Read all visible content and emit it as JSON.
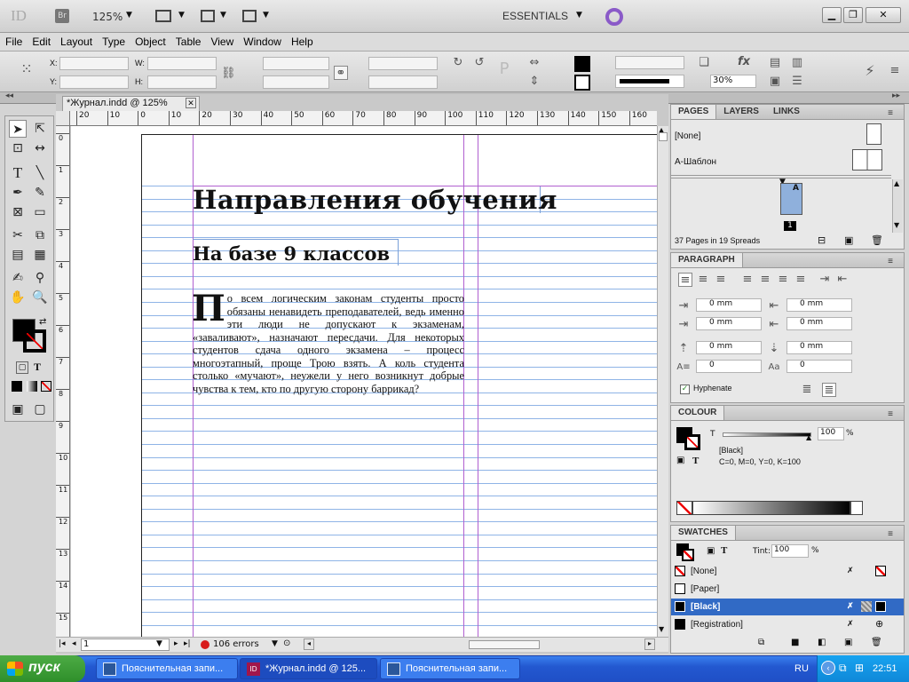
{
  "app": {
    "logo": "ID",
    "bridge_button": "Br",
    "zoom": "125%",
    "workspace": "ESSENTIALS"
  },
  "menu": [
    "File",
    "Edit",
    "Layout",
    "Type",
    "Object",
    "Table",
    "View",
    "Window",
    "Help"
  ],
  "control": {
    "x_label": "X:",
    "y_label": "Y:",
    "w_label": "W:",
    "h_label": "H:",
    "stroke_pct": "30%"
  },
  "document": {
    "tab_title": "*Журнал.indd @ 125%",
    "h_ruler_ticks": [
      "20",
      "10",
      "0",
      "10",
      "20",
      "30",
      "40",
      "50",
      "60",
      "70",
      "80",
      "90",
      "100",
      "110",
      "120",
      "130",
      "140",
      "150",
      "160"
    ],
    "v_ruler_ticks": [
      "0",
      "1",
      "2",
      "3",
      "4",
      "5",
      "6",
      "7",
      "8",
      "9",
      "10",
      "11",
      "12",
      "13",
      "14",
      "15"
    ],
    "heading": "Направления обучения",
    "subheading": "На базе 9 классов",
    "drop_cap": "П",
    "body_text": "о всем логическим законам студенты просто обязаны ненавидеть преподавателей, ведь именно эти люди не допускают к экзаменам, «заваливают», назначают пересдачи. Для некоторых студентов сдача одного экзамена – процесс многоэтапный, проще Трою взять. А коль студента столько «мучают», неужели у него возникнут добрые чувства к тем, кто по другую сторону баррикад?"
  },
  "status": {
    "page": "1",
    "errors": "106 errors"
  },
  "pages_panel": {
    "tabs": [
      "PAGES",
      "LAYERS",
      "LINKS"
    ],
    "none_label": "[None]",
    "master_label": "А-Шаблон",
    "master_letter": "A",
    "page_number": "1",
    "summary": "37 Pages in 19 Spreads"
  },
  "paragraph_panel": {
    "title": "PARAGRAPH",
    "left_indent": "0 mm",
    "right_indent": "0 mm",
    "first_indent": "0 mm",
    "last_indent": "0 mm",
    "space_before": "0 mm",
    "space_after": "0 mm",
    "dropcap_lines": "0",
    "dropcap_chars": "0",
    "hyphenate": "Hyphenate"
  },
  "colour_panel": {
    "title": "COLOUR",
    "t_label": "T",
    "value": "100",
    "unit": "%",
    "name": "[Black]",
    "cmyk": "C=0, M=0, Y=0, K=100"
  },
  "swatches_panel": {
    "title": "SWATCHES",
    "tint_label": "Tint:",
    "tint_value": "100",
    "tint_unit": "%",
    "items": [
      "[None]",
      "[Paper]",
      "[Black]",
      "[Registration]"
    ],
    "selected": "[Black]"
  },
  "taskbar": {
    "start": "пуск",
    "tasks": [
      "Пояснительная запи...",
      "*Журнал.indd @ 125...",
      "Пояснительная запи..."
    ],
    "lang": "RU",
    "clock": "22:51"
  },
  "colors": {
    "selection": "#316ac5",
    "baseline_grid": "#8fb4e6",
    "margin_guide": "#b060d0",
    "taskbar": "#2358d0"
  }
}
